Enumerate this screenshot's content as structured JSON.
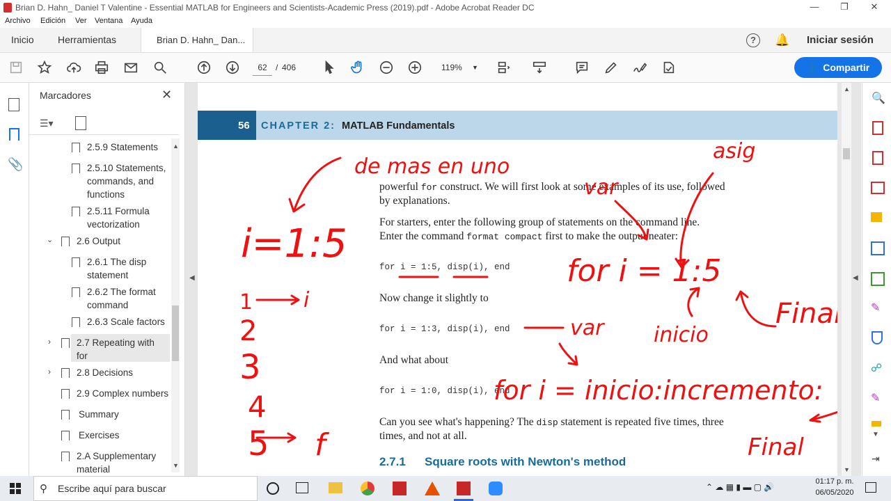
{
  "window": {
    "title": "Brian D. Hahn_ Daniel T Valentine - Essential MATLAB for Engineers and Scientists-Academic Press (2019).pdf - Adobe Acrobat Reader DC"
  },
  "menu": [
    "Archivo",
    "Edición",
    "Ver",
    "Ventana",
    "Ayuda"
  ],
  "tabs": {
    "home": "Inicio",
    "tools": "Herramientas",
    "doc": "Brian D. Hahn_ Dan...",
    "signin": "Iniciar sesión"
  },
  "toolbar": {
    "page_current": "62",
    "page_sep": "/",
    "page_total": "406",
    "zoom": "119%",
    "share": "Compartir"
  },
  "bookmarks": {
    "title": "Marcadores",
    "items": [
      "2.5.9 Statements",
      "2.5.10 Statements, commands, and functions",
      "2.5.11 Formula vectorization",
      "2.6 Output",
      "2.6.1 The disp statement",
      "2.6.2 The format command",
      "2.6.3 Scale factors",
      "2.7 Repeating with for",
      "2.8 Decisions",
      "2.9 Complex numbers",
      "Summary",
      "Exercises",
      "2.A Supplementary material"
    ]
  },
  "page": {
    "number": "56",
    "chapter": "CHAPTER 2:",
    "chapter_title": "MATLAB Fundamentals",
    "p1a": "powerful ",
    "p1code": "for",
    "p1b": " construct. We will first look at some examples of its use, followed",
    "p1c": "by explanations.",
    "p2a": "For starters, enter the following group of statements on the command line.",
    "p2b": "Enter the command ",
    "p2code": "format compact",
    "p2c": " first to make the output neater:",
    "code1": "for i = 1:5, disp(i), end",
    "p3": "Now change it slightly to",
    "code2": "for i = 1:3, disp(i), end",
    "p4": "And what about",
    "code3": "for i = 1:0, disp(i), end",
    "p5a": "Can you see what's happening? The ",
    "p5code": "disp",
    "p5b": " statement is repeated five times, three",
    "p5c": "times, and not at all.",
    "section_num": "2.7.1",
    "section_title": "Square roots with Newton's method"
  },
  "annotations": {
    "de_mas": "de mas en uno",
    "asig": "asig",
    "var1": "var",
    "for_eq": "for  i = 1:5",
    "i_eq": "i=1:5",
    "inicio": "inicio",
    "final1": "Final",
    "var2": "var",
    "for_gen": "for  i = inicio:incremento:",
    "final2": "Final",
    "n1": "1",
    "arrow_i": "i",
    "n2": "2",
    "n3": "3",
    "n4": "4",
    "n5": "5",
    "arrow_f": "f"
  },
  "taskbar": {
    "search": "Escribe aquí para buscar",
    "time": "01:17 p. m.",
    "date": "06/05/2020"
  },
  "colors": {
    "accent": "#1473e6",
    "chapter_bar": "#bcd6ea",
    "chapter_text": "#1a6b9a",
    "ink": "#ee1111"
  }
}
